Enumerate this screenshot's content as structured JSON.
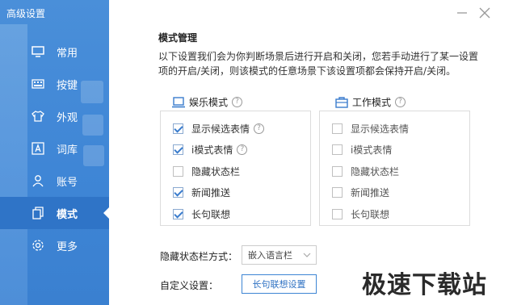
{
  "window": {
    "title": "高级设置"
  },
  "nav": [
    {
      "id": "common",
      "label": "常用",
      "icon": "monitor-icon"
    },
    {
      "id": "keys",
      "label": "按键",
      "icon": "keyboard-icon"
    },
    {
      "id": "look",
      "label": "外观",
      "icon": "shirt-icon"
    },
    {
      "id": "lexicon",
      "label": "词库",
      "icon": "letter-a-icon"
    },
    {
      "id": "account",
      "label": "账号",
      "icon": "person-icon"
    },
    {
      "id": "mode",
      "label": "模式",
      "icon": "copy-icon",
      "active": true
    },
    {
      "id": "more",
      "label": "更多",
      "icon": "gear-icon"
    }
  ],
  "mode_management": {
    "title": "模式管理",
    "description": "以下设置我们会为你判断场景后进行开启和关闭，您若手动进行了某一设置项的开启/关闭，则该模式的任意场景下该设置项都会保持开启/关闭。"
  },
  "entertainment": {
    "title": "娱乐模式",
    "help": "?",
    "options": [
      {
        "label": "显示候选表情",
        "checked": true,
        "help": true
      },
      {
        "label": "i模式表情",
        "checked": true,
        "help": true
      },
      {
        "label": "隐藏状态栏",
        "checked": false
      },
      {
        "label": "新闻推送",
        "checked": true
      },
      {
        "label": "长句联想",
        "checked": true
      }
    ]
  },
  "work": {
    "title": "工作模式",
    "help": "?",
    "options": [
      {
        "label": "显示候选表情",
        "checked": false
      },
      {
        "label": "i模式表情",
        "checked": false
      },
      {
        "label": "隐藏状态栏",
        "checked": false
      },
      {
        "label": "新闻推送",
        "checked": false
      },
      {
        "label": "长句联想",
        "checked": false
      }
    ]
  },
  "statusbar": {
    "label": "隐藏状态栏方式：",
    "value": "嵌入语言栏"
  },
  "custom": {
    "label": "自定义设置：",
    "button": "长句联想设置"
  },
  "watermark": "极速下载站",
  "colors": {
    "sidebar": "#3f86d6",
    "active": "#2f74c7",
    "accent": "#3a7ccd"
  }
}
